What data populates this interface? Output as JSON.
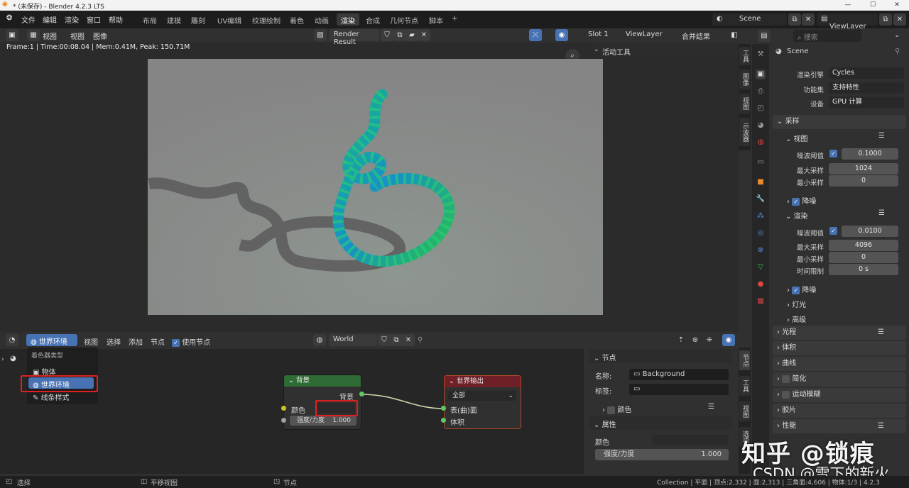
{
  "window": {
    "title": "* (未保存) - Blender 4.2.3 LTS",
    "min": "—",
    "max": "☐",
    "close": "✕"
  },
  "menu": [
    "文件",
    "编辑",
    "渲染",
    "窗口",
    "帮助"
  ],
  "workspaces": [
    "布局",
    "建模",
    "雕刻",
    "UV编辑",
    "纹理绘制",
    "着色",
    "动画",
    "渲染",
    "合成",
    "几何节点",
    "脚本",
    "+"
  ],
  "active_workspace": "渲染",
  "scene": {
    "label": "Scene",
    "viewlayer": "ViewLayer"
  },
  "image_editor": {
    "menu_view": "视图",
    "menu_image": "图像",
    "image_name": "Render Result",
    "slot": "Slot 1",
    "layer": "ViewLayer",
    "pass": "合并结果",
    "stats": "Frame:1 | Time:00:08.04 | Mem:0.41M, Peak: 150.71M"
  },
  "active_tool": {
    "title": "活动工具"
  },
  "side_tabs": [
    "工具",
    "图像",
    "视图",
    "示波器"
  ],
  "search": {
    "placeholder": "搜索"
  },
  "properties": {
    "scene_name": "Scene",
    "engine_label": "渲染引擎",
    "engine": "Cycles",
    "feature_label": "功能集",
    "feature": "支持特性",
    "device_label": "设备",
    "device": "GPU 计算",
    "sampling": "采样",
    "viewport": "视图",
    "noise_label": "噪波阈值",
    "vp_noise": "0.1000",
    "max_label": "最大采样",
    "vp_max": "1024",
    "min_label": "最小采样",
    "vp_min": "0",
    "denoise": "降噪",
    "render": "渲染",
    "r_noise": "0.0100",
    "r_max": "4096",
    "r_min": "0",
    "time_label": "时间限制",
    "r_time": "0 s",
    "denoise2": "降噪",
    "lights": "灯光",
    "advanced": "高级",
    "sections": [
      "光程",
      "体积",
      "曲线",
      "简化",
      "运动模糊",
      "胶片",
      "性能"
    ]
  },
  "node_editor": {
    "type_label": "世界环境",
    "menus": [
      "视图",
      "选择",
      "添加",
      "节点"
    ],
    "use_nodes": "使用节点",
    "world": "World",
    "popup": {
      "title": "着色器类型",
      "items": [
        "物体",
        "世界环境",
        "线条样式"
      ]
    },
    "bg_node": {
      "title": "背景",
      "out": "背景",
      "color": "颜色",
      "strength_label": "强度/力度",
      "strength": "1.000"
    },
    "out_node": {
      "title": "世界输出",
      "target": "全部",
      "surface": "表(曲)面",
      "volume": "体积"
    },
    "panel": {
      "tab": "节点",
      "node_section": "节点",
      "name_label": "名称:",
      "name": "Background",
      "label_label": "标签:",
      "label": "",
      "color_section": "颜色",
      "props": "属性",
      "p_color": "颜色",
      "p_strength_label": "强度/力度",
      "p_strength": "1.000"
    },
    "vtabs": [
      "节点",
      "工具",
      "视图",
      "选项"
    ]
  },
  "status": {
    "select": "选择",
    "pan": "平移视图",
    "node": "节点",
    "info": "Collection | 平面 | 顶点:2,332 | 面:2,313 | 三角面:4,606 | 物体:1/3 | 4.2.3"
  },
  "watermark": {
    "line1": "知乎 @锁痕",
    "line2": "CSDN @雪下的新火"
  }
}
